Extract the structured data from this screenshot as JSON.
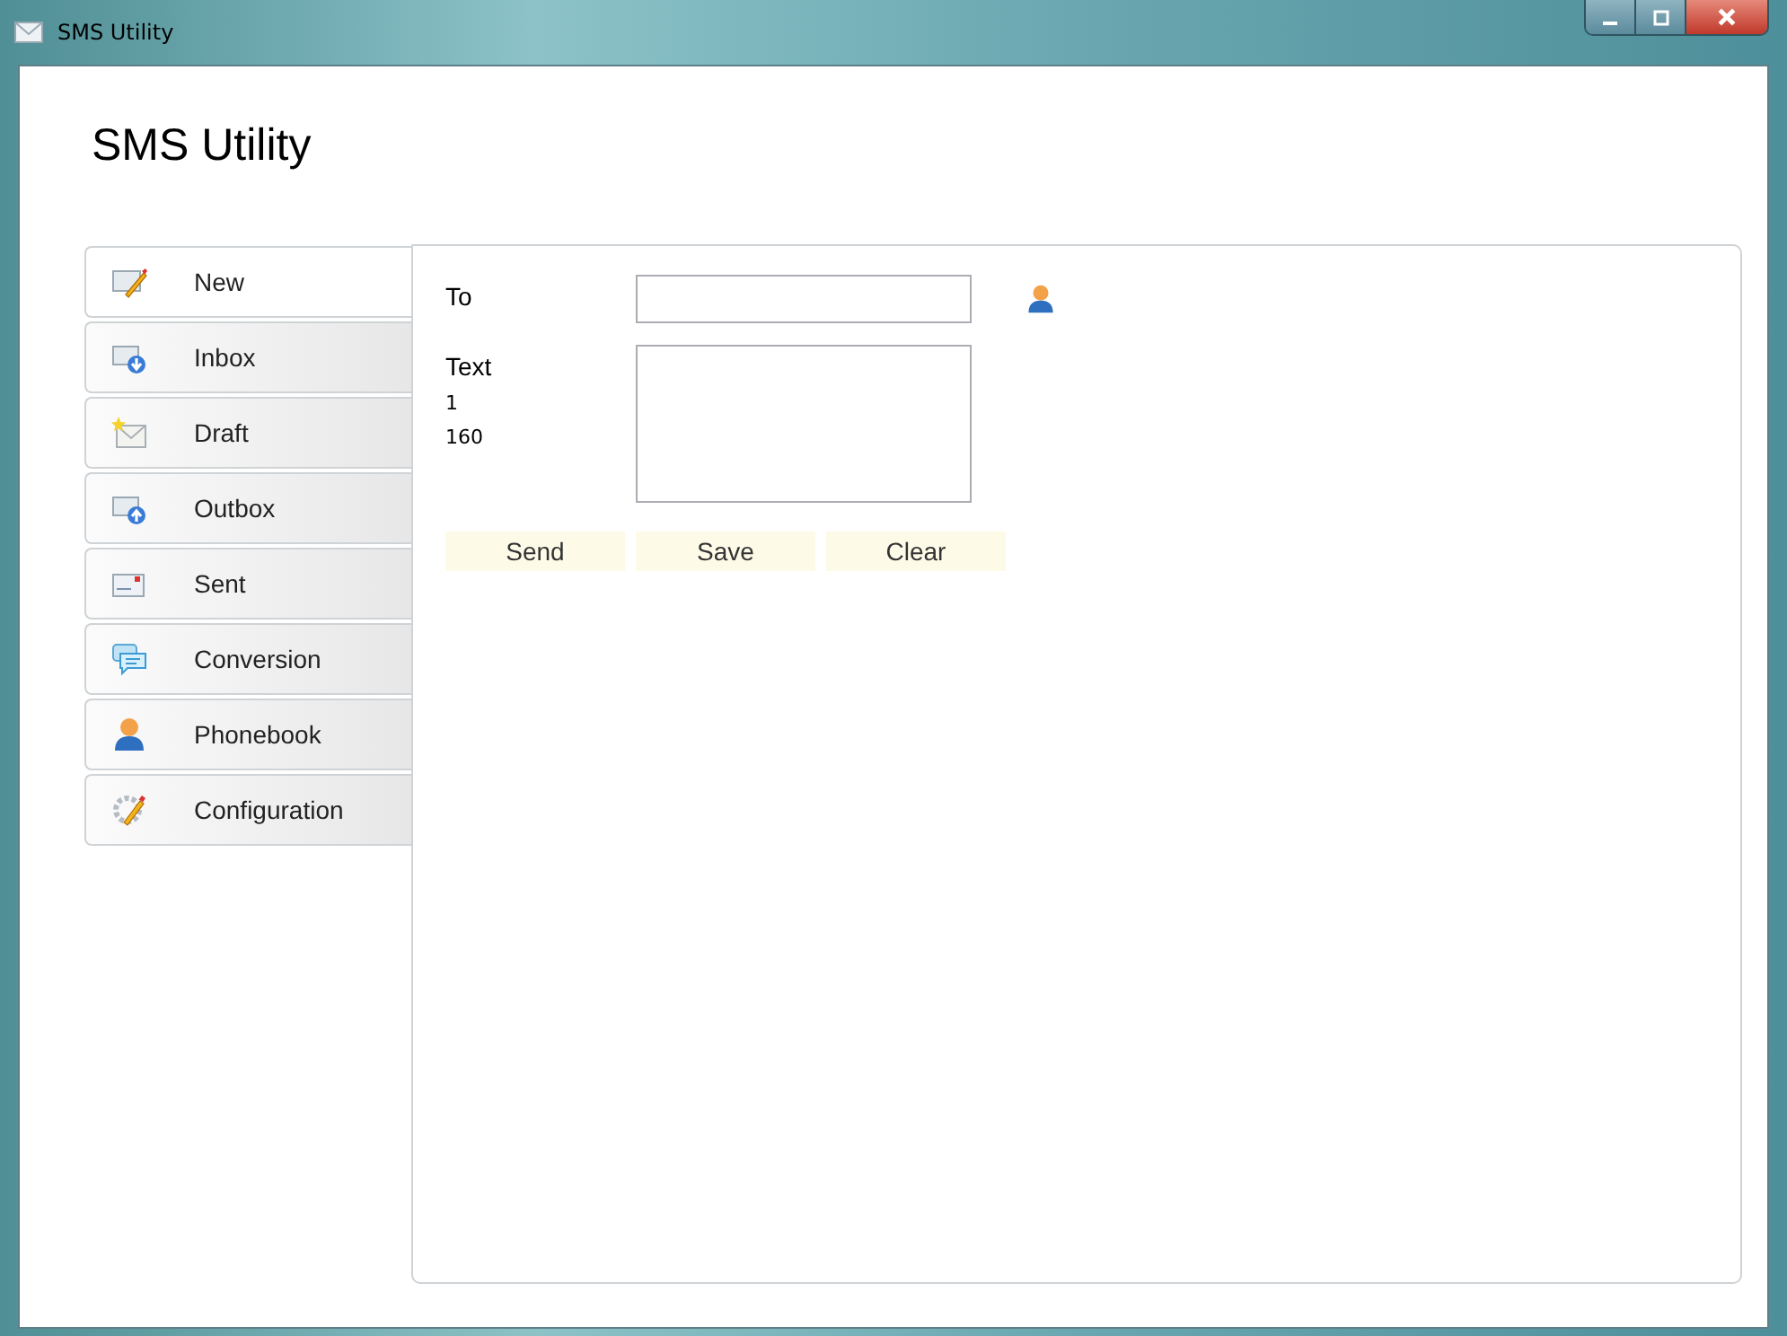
{
  "window": {
    "title": "SMS Utility"
  },
  "heading": "SMS Utility",
  "tabs": [
    {
      "label": "New",
      "kind": "compose",
      "selected": true
    },
    {
      "label": "Inbox",
      "kind": "inbox",
      "selected": false
    },
    {
      "label": "Draft",
      "kind": "draft",
      "selected": false
    },
    {
      "label": "Outbox",
      "kind": "outbox",
      "selected": false
    },
    {
      "label": "Sent",
      "kind": "sent",
      "selected": false
    },
    {
      "label": "Conversion",
      "kind": "chat",
      "selected": false
    },
    {
      "label": "Phonebook",
      "kind": "person",
      "selected": false
    },
    {
      "label": "Configuration",
      "kind": "config",
      "selected": false
    }
  ],
  "form": {
    "to_label": "To",
    "text_label": "Text",
    "message_count": "1",
    "chars_left": "160"
  },
  "buttons": [
    "Send",
    "Save",
    "Clear"
  ]
}
